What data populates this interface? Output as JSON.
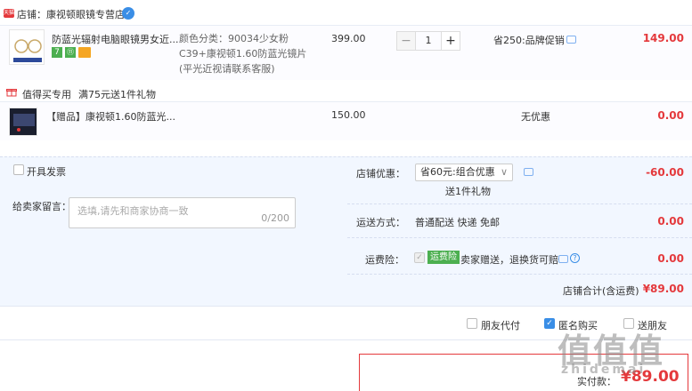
{
  "shop": {
    "badge": "天猫",
    "label": "店铺：康视顿眼镜专营店",
    "icon": "ww-icon"
  },
  "item1": {
    "title": "防蓝光辐射电脑眼镜男女近...",
    "sku": "颜色分类：90034少女粉C39+康视顿1.60防蓝光镜片(平光近视请联系客服)",
    "price": "399.00",
    "qty": "1",
    "minus": "−",
    "plus": "+",
    "promo": "省250:品牌促销",
    "total": "149.00",
    "badges": [
      "7",
      "⑪"
    ]
  },
  "promo_line": {
    "label": "值得买专用",
    "desc": "满75元送1件礼物"
  },
  "item2": {
    "title": "【赠品】康视顿1.60防蓝光...",
    "price": "150.00",
    "promo": "无优惠",
    "total": "0.00"
  },
  "invoice": {
    "label": "开具发票"
  },
  "memo": {
    "label": "给卖家留言：",
    "placeholder": "选填,请先和商家协商一致",
    "counter": "0/200"
  },
  "shop_discount": {
    "label": "店铺优惠：",
    "selected": "省60元:组合优惠",
    "gift": "送1件礼物",
    "amount": "-60.00"
  },
  "shipping": {
    "label": "运送方式：",
    "value": "普通配送 快递 免邮",
    "amount": "0.00"
  },
  "insurance": {
    "label": "运费险：",
    "tag": "运费险",
    "desc": "卖家赠送，退换货可赔",
    "amount": "0.00"
  },
  "shop_total": {
    "label": "店铺合计(含运费)",
    "amount": "¥89.00"
  },
  "options": {
    "friend_pay": "朋友代付",
    "anon": "匿名购买",
    "gift": "送朋友"
  },
  "final": {
    "label": "实付款：",
    "amount": "¥89.00"
  },
  "watermark": {
    "brand": "值值值",
    "url": "zhidemai"
  },
  "colors": {
    "accent": "#e4393c",
    "blue": "#3a8ee6",
    "panel": "#f2f7ff"
  }
}
